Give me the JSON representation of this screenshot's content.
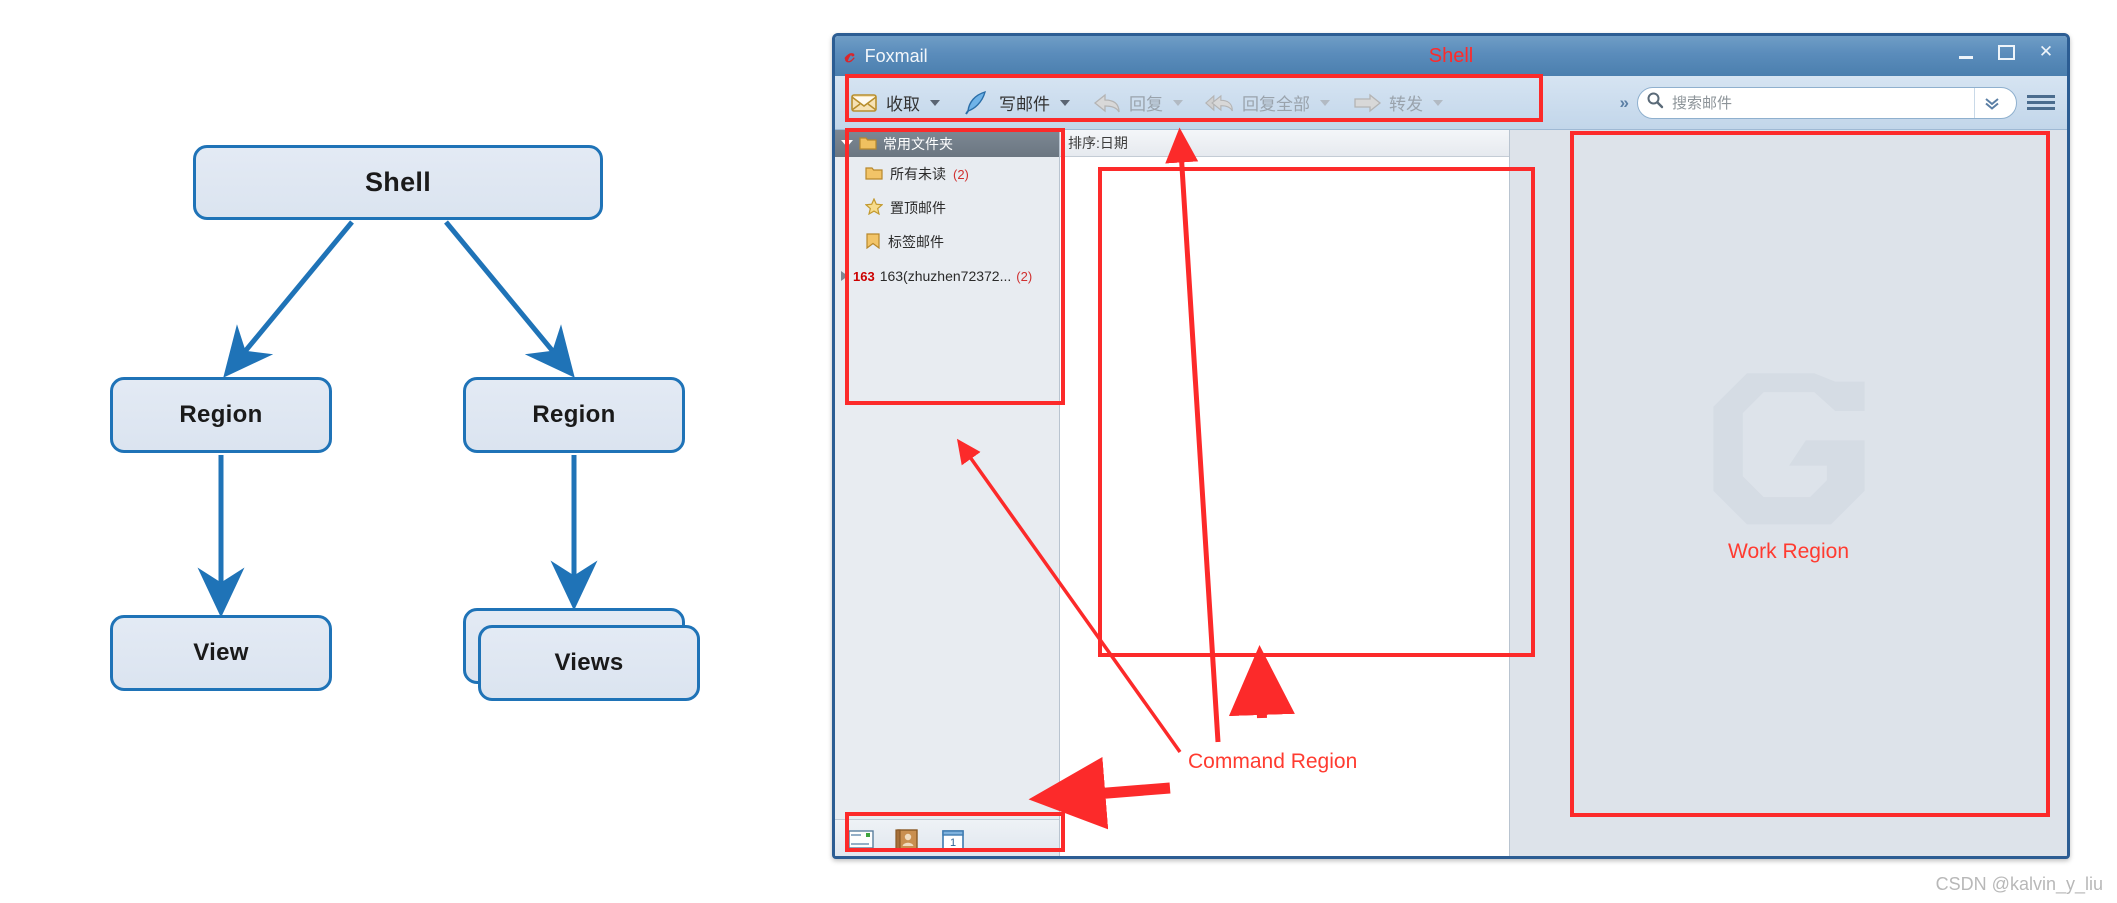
{
  "diagram": {
    "nodes": [
      {
        "id": "shell",
        "label": "Shell"
      },
      {
        "id": "region-l",
        "label": "Region"
      },
      {
        "id": "region-r",
        "label": "Region"
      },
      {
        "id": "view",
        "label": "View"
      },
      {
        "id": "views",
        "label": "Views"
      }
    ],
    "edges": [
      {
        "from": "shell",
        "to": "region-l"
      },
      {
        "from": "shell",
        "to": "region-r"
      },
      {
        "from": "region-l",
        "to": "view"
      },
      {
        "from": "region-r",
        "to": "views"
      }
    ],
    "colors": {
      "stroke": "#1f73b7",
      "fill": "#dfe7f2",
      "text": "#1a1a1a"
    }
  },
  "foxmail": {
    "titlebar": {
      "app_name": "Foxmail",
      "logo_icon": "foxmail-g-logo-icon",
      "annotation_title": "Shell",
      "minimize_icon": "minimize-icon",
      "maximize_icon": "maximize-icon",
      "close_icon": "close-icon",
      "close_glyph": "✕"
    },
    "toolbar": {
      "items": [
        {
          "label": "收取",
          "icon": "inbox-icon",
          "enabled": true,
          "has_dropdown": true
        },
        {
          "label": "写邮件",
          "icon": "compose-quill-icon",
          "enabled": true,
          "has_dropdown": true
        },
        {
          "label": "回复",
          "icon": "reply-arrow-icon",
          "enabled": false,
          "has_dropdown": true
        },
        {
          "label": "回复全部",
          "icon": "reply-all-arrow-icon",
          "enabled": false,
          "has_dropdown": true
        },
        {
          "label": "转发",
          "icon": "forward-arrow-icon",
          "enabled": false,
          "has_dropdown": true
        }
      ],
      "overflow_glyph": "»",
      "overflow_icon": "overflow-chevrons-icon",
      "search": {
        "placeholder": "搜索邮件",
        "value": "",
        "search_icon": "search-icon",
        "dropdown_icon": "chevron-double-down-icon",
        "dropdown_glyph": "⌄"
      },
      "list_toggle_icon": "list-view-icon"
    },
    "sidebar": {
      "header": {
        "label": "常用文件夹",
        "icon": "folder-icon",
        "expand_icon": "triangle-down-icon"
      },
      "items": [
        {
          "label": "所有未读",
          "icon": "folder-icon",
          "count": "(2)"
        },
        {
          "label": "置顶邮件",
          "icon": "star-icon",
          "count": ""
        },
        {
          "label": "标签邮件",
          "icon": "bookmark-icon",
          "count": ""
        }
      ],
      "account": {
        "badge": "163",
        "label": "163(zhuzhen72372...",
        "count": "(2)",
        "expand_icon": "triangle-right-icon"
      },
      "footer_icons": [
        {
          "name": "mail-icon",
          "label": "邮件"
        },
        {
          "name": "contacts-icon",
          "label": "通讯录"
        },
        {
          "name": "calendar-icon",
          "label": "1"
        }
      ]
    },
    "message_list": {
      "sort_label": "排序:日期",
      "rows": []
    },
    "work_area": {
      "watermark_icon": "foxmail-g-watermark-icon",
      "annotation_label": "Work Region"
    }
  },
  "annotations": {
    "command_region_label": "Command Region",
    "highlight_color": "#fc2a2a",
    "boxes": [
      {
        "name": "toolbar-highlight"
      },
      {
        "name": "sidebar-highlight"
      },
      {
        "name": "message-list-highlight"
      },
      {
        "name": "work-region-highlight"
      },
      {
        "name": "sidebar-footer-highlight"
      }
    ]
  },
  "watermark": {
    "text": "CSDN @kalvin_y_liu"
  }
}
